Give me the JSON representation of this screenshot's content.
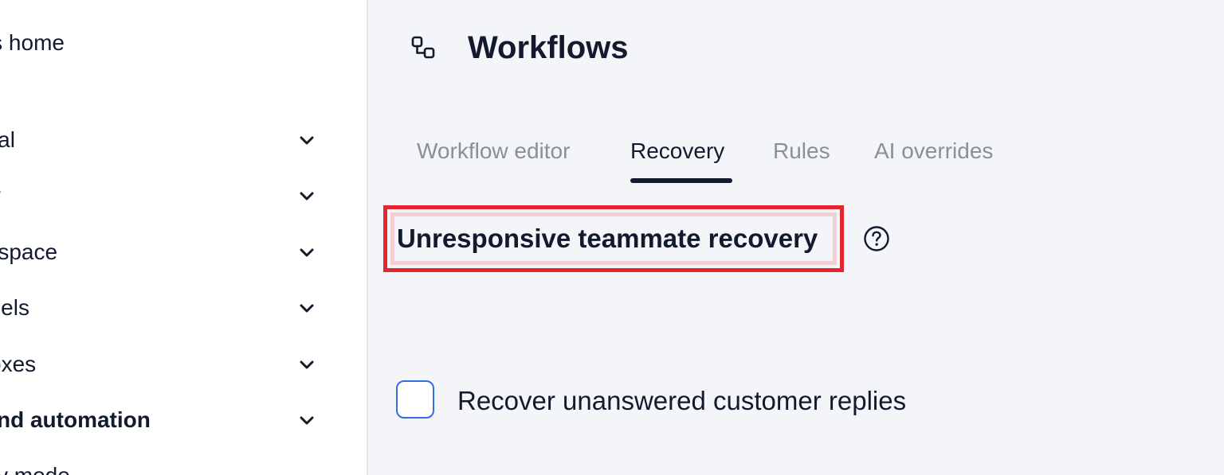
{
  "sidebar": {
    "home_label": "ngs home",
    "items": [
      {
        "label": "sonal",
        "bold": false
      },
      {
        "label": "urity",
        "bold": false
      },
      {
        "label": "rkspace",
        "bold": false
      },
      {
        "label": "nnels",
        "bold": false
      },
      {
        "label": "oxes",
        "bold": false
      },
      {
        "label": "nd automation",
        "bold": true
      },
      {
        "label": "y mode",
        "bold": false
      }
    ]
  },
  "main": {
    "title": "Workflows",
    "title_icon": "workflow-icon",
    "tabs": [
      {
        "label": "Workflow editor",
        "active": false
      },
      {
        "label": "Recovery",
        "active": true
      },
      {
        "label": "Rules",
        "active": false
      },
      {
        "label": "AI overrides",
        "active": false
      }
    ],
    "section_title": "Unresponsive teammate recovery",
    "help_icon": "help-circle-icon",
    "checkbox_label": "Recover unanswered customer replies",
    "checkbox_checked": false
  },
  "colors": {
    "highlight": "#e3262e",
    "checkbox_border": "#2f6ee8",
    "text": "#121a2e",
    "muted_text": "#8a8f9b"
  }
}
